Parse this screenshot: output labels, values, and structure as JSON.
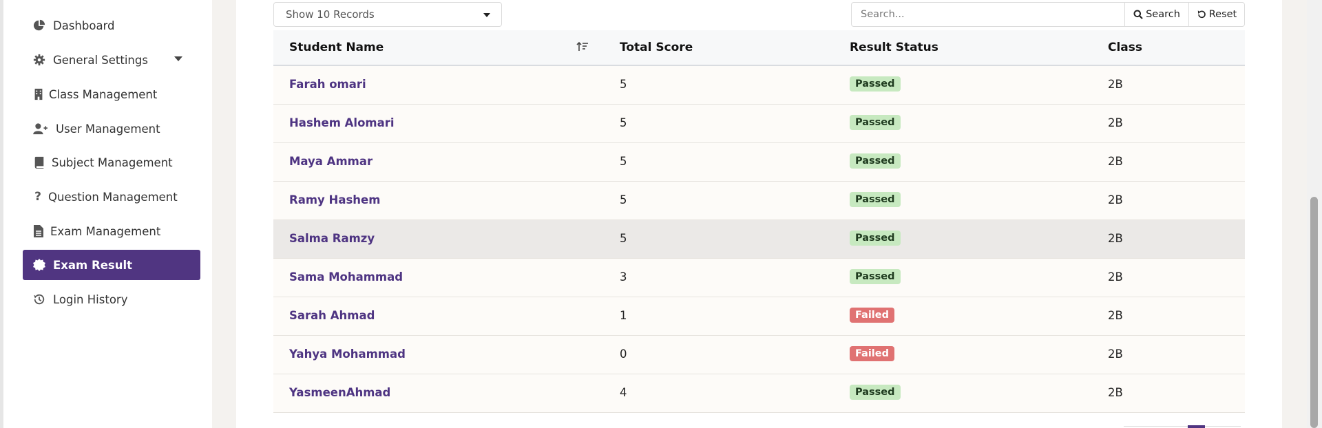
{
  "sidebar": {
    "items": [
      {
        "label": "Dashboard",
        "icon": "pie-chart-icon"
      },
      {
        "label": "General Settings",
        "icon": "gear-icon"
      },
      {
        "label": "Class Management",
        "icon": "building-icon"
      },
      {
        "label": "User Management",
        "icon": "user-plus-icon"
      },
      {
        "label": "Subject Management",
        "icon": "book-icon"
      },
      {
        "label": "Question Management",
        "icon": "question-icon"
      },
      {
        "label": "Exam Management",
        "icon": "document-icon"
      },
      {
        "label": "Exam Result",
        "icon": "badge-icon"
      },
      {
        "label": "Login History",
        "icon": "history-icon"
      }
    ],
    "active": "Exam Result",
    "accent": "#503581"
  },
  "toolbar": {
    "records_select": "Show 10 Records",
    "search_placeholder": "Search...",
    "search_label": "Search",
    "reset_label": "Reset"
  },
  "table": {
    "columns": [
      "Student Name",
      "Total Score",
      "Result Status",
      "Class"
    ],
    "rows": [
      {
        "name": "Farah omari",
        "score": "5",
        "status": "Passed",
        "class": "2B"
      },
      {
        "name": "Hashem Alomari",
        "score": "5",
        "status": "Passed",
        "class": "2B"
      },
      {
        "name": "Maya Ammar",
        "score": "5",
        "status": "Passed",
        "class": "2B"
      },
      {
        "name": "Ramy Hashem",
        "score": "5",
        "status": "Passed",
        "class": "2B"
      },
      {
        "name": "Salma Ramzy",
        "score": "5",
        "status": "Passed",
        "class": "2B"
      },
      {
        "name": "Sama Mohammad",
        "score": "3",
        "status": "Passed",
        "class": "2B"
      },
      {
        "name": "Sarah Ahmad",
        "score": "1",
        "status": "Failed",
        "class": "2B"
      },
      {
        "name": "Yahya Mohammad",
        "score": "0",
        "status": "Failed",
        "class": "2B"
      },
      {
        "name": "YasmeenAhmad",
        "score": "4",
        "status": "Passed",
        "class": "2B"
      }
    ],
    "status_colors": {
      "Passed": "#c7e9c0",
      "Failed": "#e07272"
    }
  }
}
